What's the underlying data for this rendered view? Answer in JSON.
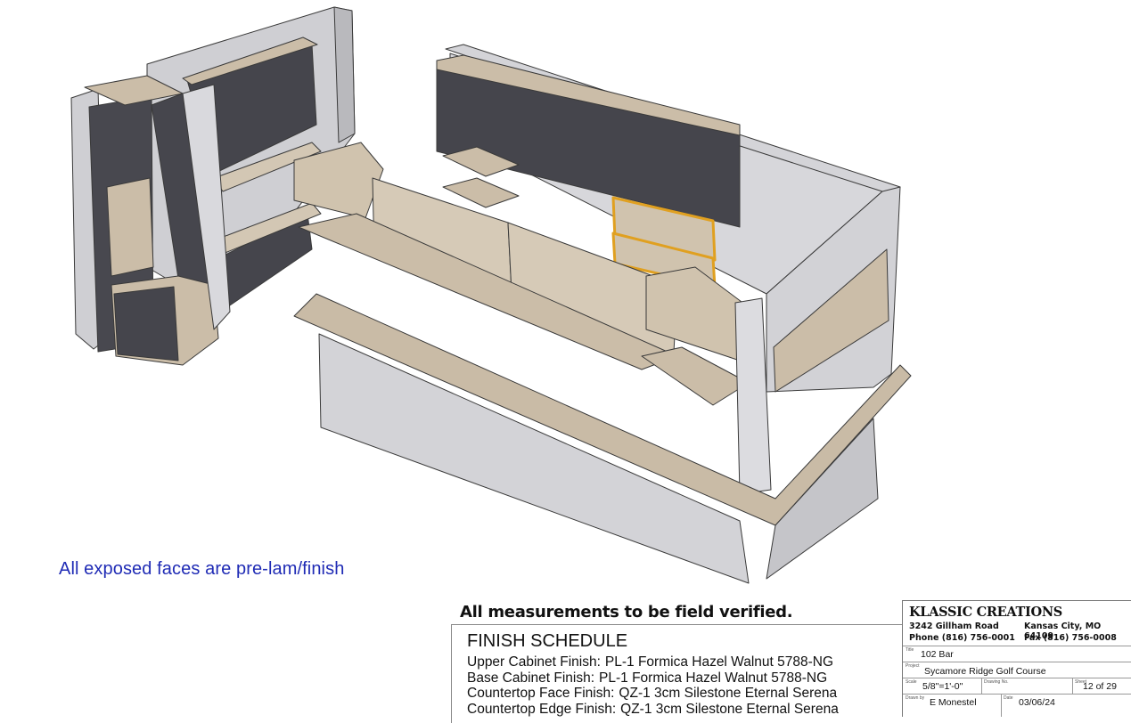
{
  "note_text": "All exposed faces are pre-lam/finish",
  "verification_text": "All measurements to be field verified.",
  "finish_schedule": {
    "title": "FINISH SCHEDULE",
    "rows": [
      {
        "label": "Upper Cabinet Finish:",
        "value": "PL-1 Formica Hazel Walnut 5788-NG"
      },
      {
        "label": "Base Cabinet Finish:",
        "value": "PL-1 Formica Hazel Walnut 5788-NG"
      },
      {
        "label": "Countertop Face Finish:",
        "value": "QZ-1 3cm Silestone Eternal Serena"
      },
      {
        "label": "Countertop Edge Finish:",
        "value": "QZ-1 3cm Silestone Eternal Serena"
      }
    ]
  },
  "title_block": {
    "company": "KLASSIC CREATIONS",
    "address": "3242 Gillham Road",
    "city": "Kansas City, MO 64109",
    "phone": "Phone (816) 756-0001",
    "fax": "Fax (816) 756-0008",
    "title_label": "Title",
    "title": "102 Bar",
    "project_label": "Project",
    "project": "Sycamore Ridge Golf Course",
    "scale_label": "Scale",
    "scale": "5/8\"=1'-0\"",
    "drawing_no_label": "Drawing No.",
    "sheet_label": "Sheet",
    "sheet": "12 of 29",
    "drawn_by_label": "Drawn by",
    "drawn_by": "E Monestel",
    "date_label": "Date",
    "date": "03/06/24"
  },
  "colors": {
    "cabinet_dark": "#45454c",
    "wood": "#c9bba6",
    "wood_light": "#d6cab7",
    "wall": "#c8c8cc",
    "wall_light": "#dcdce0",
    "outline": "#3a3a3a",
    "highlight": "#e0a020",
    "note_blue": "#1f2bb5"
  }
}
